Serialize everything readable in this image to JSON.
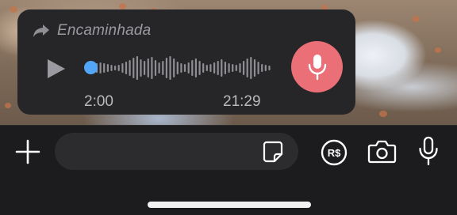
{
  "colors": {
    "bubble": "#262628",
    "mic_button": "#eb6f76",
    "playhead": "#53a6f7",
    "composer_bg": "#1c1c1e",
    "input_bg": "#2c2c2e"
  },
  "voice_message": {
    "forwarded_label": "Encaminhada",
    "forward_icon": "forward-arrow-icon",
    "play_icon": "play-icon",
    "elapsed": "2:00",
    "duration": "21:29",
    "progress": 0.0,
    "mic_icon": "microphone-icon"
  },
  "composer": {
    "add_icon": "plus-icon",
    "input_value": "",
    "sticker_icon": "sticker-icon",
    "payment_icon": "brl-payment-icon",
    "payment_symbol": "R$",
    "camera_icon": "camera-icon",
    "voice_icon": "microphone-icon"
  }
}
